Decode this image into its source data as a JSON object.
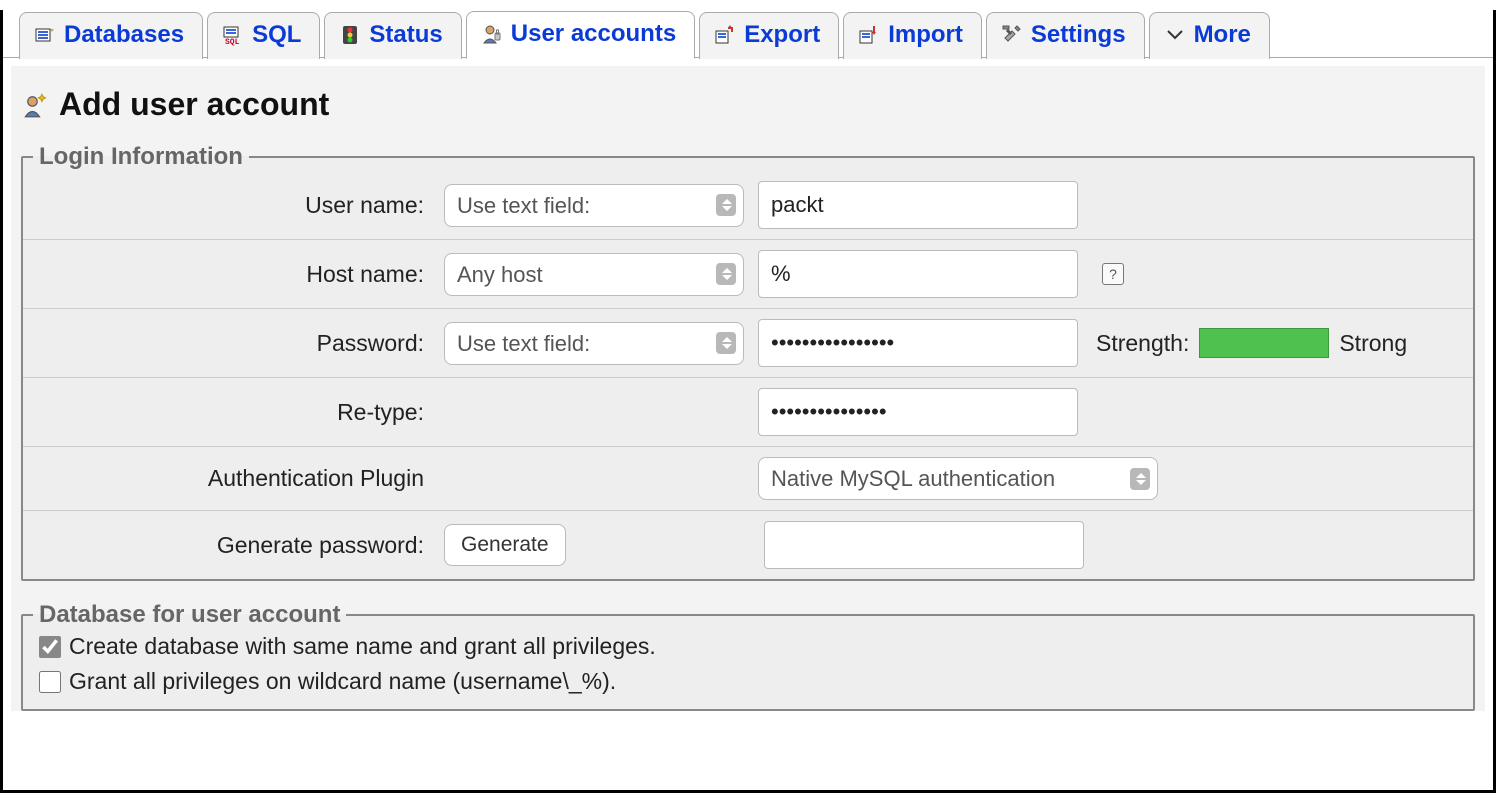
{
  "tabs": [
    {
      "label": "Databases",
      "icon": "databases-icon"
    },
    {
      "label": "SQL",
      "icon": "sql-icon"
    },
    {
      "label": "Status",
      "icon": "status-icon"
    },
    {
      "label": "User accounts",
      "icon": "user-accounts-icon"
    },
    {
      "label": "Export",
      "icon": "export-icon"
    },
    {
      "label": "Import",
      "icon": "import-icon"
    },
    {
      "label": "Settings",
      "icon": "settings-icon"
    },
    {
      "label": "More",
      "icon": "more-icon"
    }
  ],
  "active_tab_index": 3,
  "page": {
    "title": "Add user account",
    "login_section_legend": "Login Information",
    "db_section_legend": "Database for user account"
  },
  "form": {
    "username_label": "User name:",
    "username_select": "Use text field:",
    "username_value": "packt",
    "hostname_label": "Host name:",
    "hostname_select": "Any host",
    "hostname_value": "%",
    "password_label": "Password:",
    "password_select": "Use text field:",
    "password_value": "••••••••••••••••",
    "strength_label": "Strength:",
    "strength_value_label": "Strong",
    "strength_color": "#4fc14f",
    "retype_label": "Re-type:",
    "retype_value": "•••••••••••••••",
    "auth_plugin_label": "Authentication Plugin",
    "auth_plugin_select": "Native MySQL authentication",
    "generate_password_label": "Generate password:",
    "generate_button_label": "Generate",
    "generate_value": ""
  },
  "db_checkboxes": {
    "create_same_name": {
      "checked": true,
      "label": "Create database with same name and grant all privileges."
    },
    "grant_wildcard": {
      "checked": false,
      "label": "Grant all privileges on wildcard name (username\\_%)."
    }
  }
}
